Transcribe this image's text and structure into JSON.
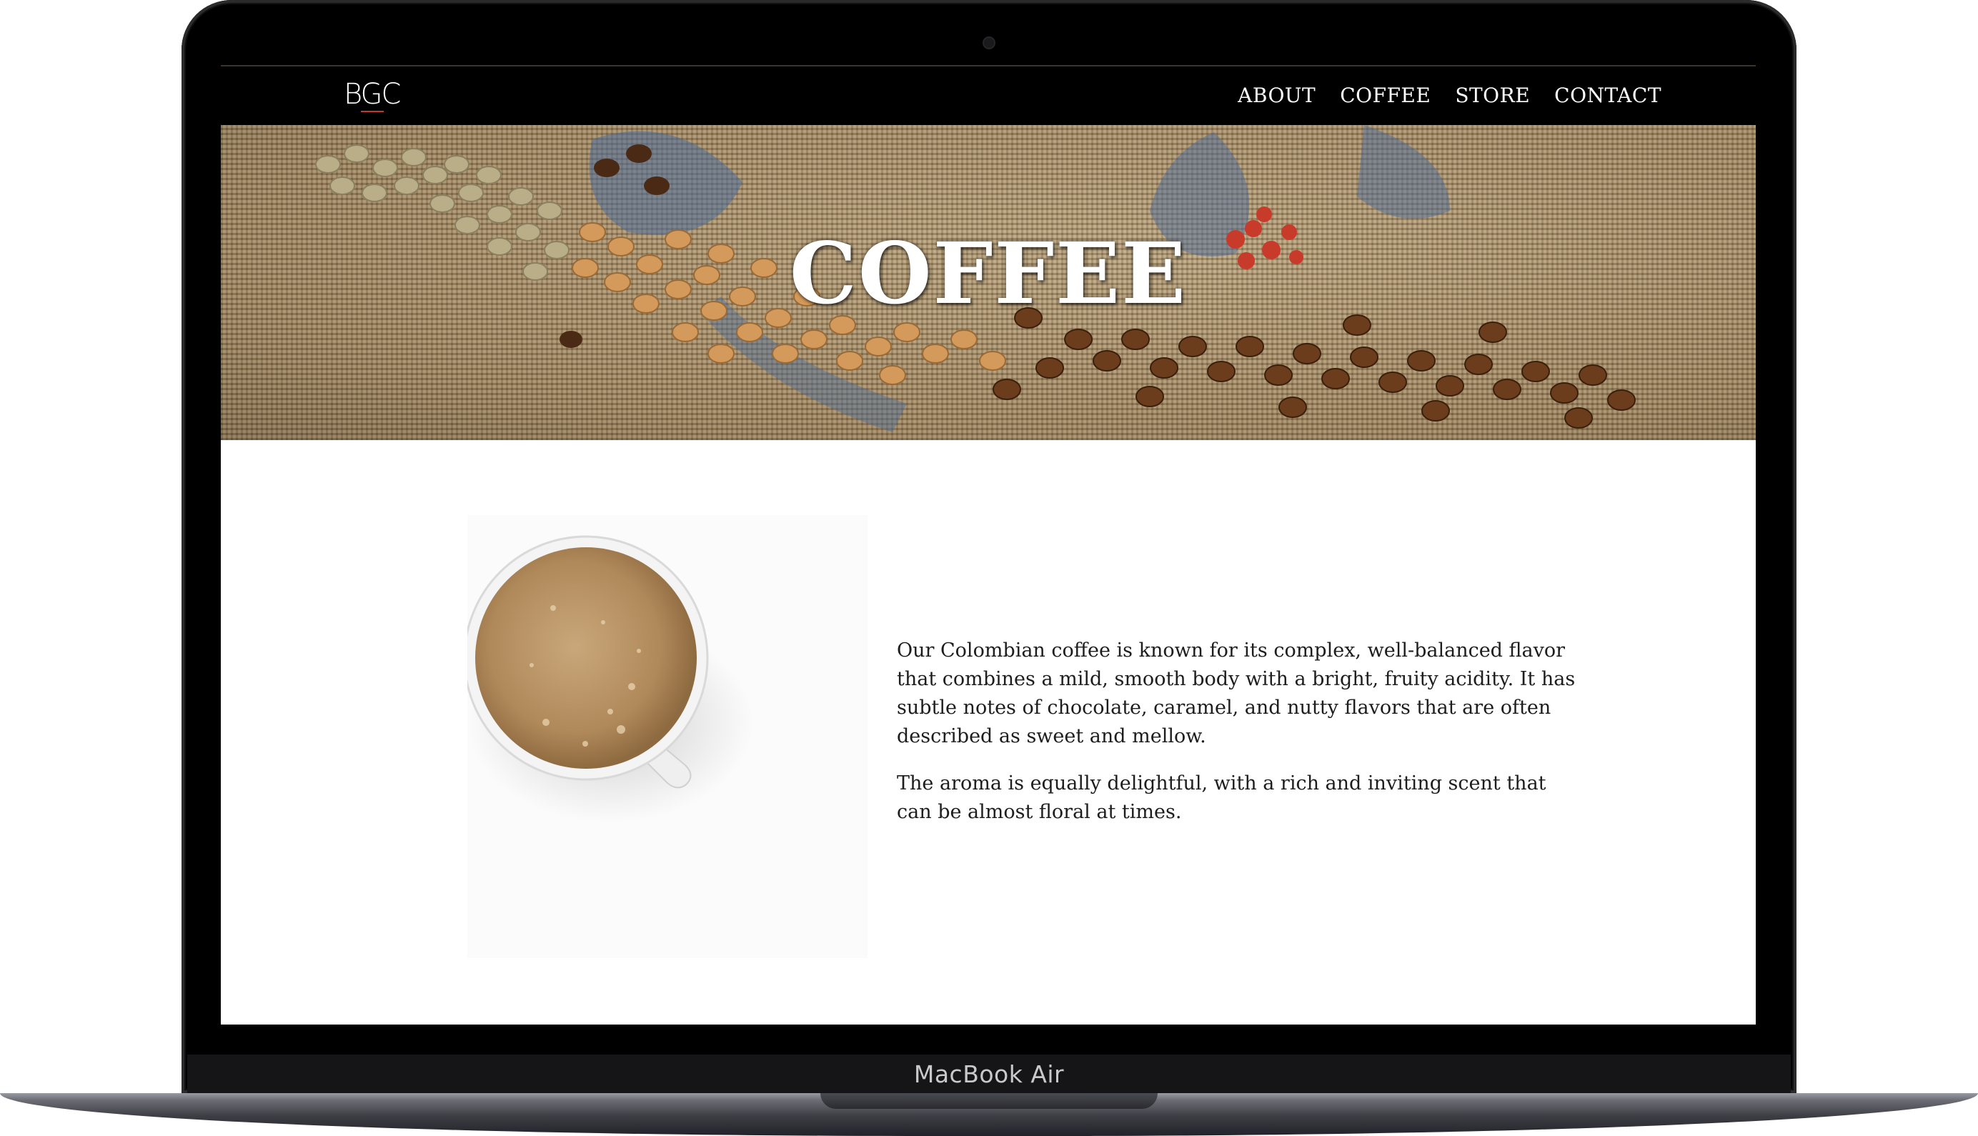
{
  "device": {
    "label": "MacBook Air"
  },
  "site": {
    "logo": "BGC",
    "nav": [
      "ABOUT",
      "COFFEE",
      "STORE",
      "CONTACT"
    ]
  },
  "hero": {
    "title": "COFFEE"
  },
  "content": {
    "paragraphs": [
      "Our Colombian coffee is known for its complex, well-balanced flavor that combines a mild, smooth body with a bright, fruity acidity. It has subtle notes of chocolate, caramel, and nutty flavors that are often described as sweet and mellow.",
      "The aroma is equally delightful, with a rich and inviting scent that can be almost floral at times."
    ]
  },
  "colors": {
    "navbar": "#000000",
    "burlap": "#a68f6e",
    "coffee_foam": "#b0895a"
  }
}
